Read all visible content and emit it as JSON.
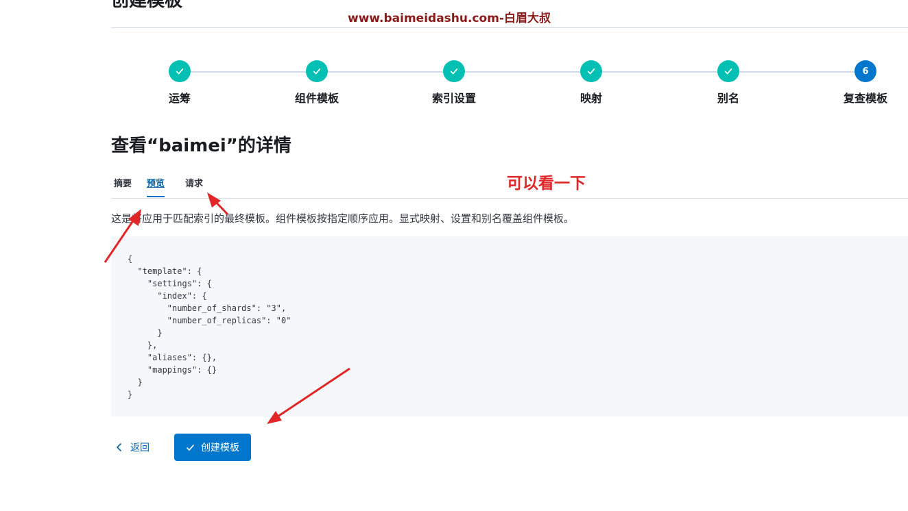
{
  "header": {
    "title": "创建模板",
    "watermark": "www.baimeidashu.com-白眉大叔"
  },
  "stepper": {
    "steps": [
      {
        "label": "运筹",
        "status": "complete"
      },
      {
        "label": "组件模板",
        "status": "complete"
      },
      {
        "label": "索引设置",
        "status": "complete"
      },
      {
        "label": "映射",
        "status": "complete"
      },
      {
        "label": "别名",
        "status": "complete"
      },
      {
        "label": "复查模板",
        "status": "current",
        "number": "6"
      }
    ]
  },
  "review": {
    "title": "查看“baimei”的详情",
    "tabs": [
      {
        "label": "摘要",
        "active": false
      },
      {
        "label": "预览",
        "active": true
      },
      {
        "label": "请求",
        "active": false
      }
    ],
    "annotation": "可以看一下",
    "description": "这是将应用于匹配索引的最终模板。组件模板按指定顺序应用。显式映射、设置和别名覆盖组件模板。",
    "code": "{\n  \"template\": {\n    \"settings\": {\n      \"index\": {\n        \"number_of_shards\": \"3\",\n        \"number_of_replicas\": \"0\"\n      }\n    },\n    \"aliases\": {},\n    \"mappings\": {}\n  }\n}"
  },
  "footer": {
    "back_label": "返回",
    "create_label": "创建模板"
  },
  "colors": {
    "step_complete": "#00bfb3",
    "step_current": "#0077cc",
    "primary": "#0077cc",
    "annotation": "#e02626",
    "watermark": "#8b1a1a"
  },
  "icons": {
    "step_complete": "check-icon",
    "back": "chevron-left-icon",
    "create": "check-icon"
  }
}
